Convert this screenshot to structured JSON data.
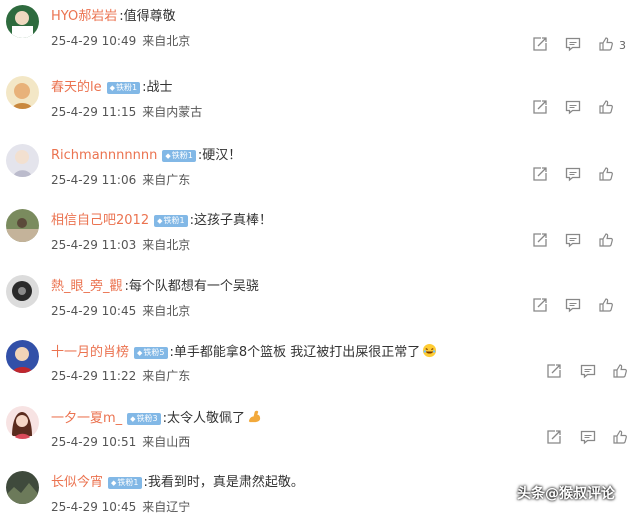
{
  "comments": [
    {
      "username": "HYO郝岩岩",
      "badge": "",
      "text": ":值得尊敬",
      "time": "25-4-29 10:49",
      "location": "来自北京",
      "likes": "3"
    },
    {
      "username": "春天的le",
      "badge": "铁粉1",
      "text": ":战士",
      "time": "25-4-29 11:15",
      "location": "来自内蒙古",
      "likes": ""
    },
    {
      "username": "Richmannnnnnn",
      "badge": "铁粉1",
      "text": ":硬汉！",
      "time": "25-4-29 11:06",
      "location": "来自广东",
      "likes": ""
    },
    {
      "username": "相信自己吧2012",
      "badge": "铁粉1",
      "text": ":这孩子真棒！",
      "time": "25-4-29 11:03",
      "location": "来自北京",
      "likes": ""
    },
    {
      "username": "熱_眼_旁_觀",
      "badge": "",
      "text": ":每个队都想有一个吴骁",
      "time": "25-4-29 10:45",
      "location": "来自北京",
      "likes": ""
    },
    {
      "username": "十一月的肖榜",
      "badge": "铁粉5",
      "text": ":单手都能拿8个篮板 我辽被打出屎很正常了",
      "time": "25-4-29 11:22",
      "location": "来自广东",
      "likes": ""
    },
    {
      "username": "一夕一夏m_",
      "badge": "铁粉3",
      "text": ":太令人敬佩了",
      "time": "25-4-29 10:51",
      "location": "来自山西",
      "likes": ""
    },
    {
      "username": "长似今宵",
      "badge": "铁粉1",
      "text": ":我看到时，真是肃然起敬。",
      "time": "25-4-29 10:45",
      "location": "来自辽宁",
      "likes": ""
    }
  ],
  "watermark": "头条@猴叔评论",
  "icons": {
    "repost": "repost-icon",
    "comment": "comment-icon",
    "like": "like-icon"
  },
  "colors": {
    "username": "#eb7350",
    "badge": "#82b8e6",
    "text": "#333333",
    "meta": "#555555",
    "icon": "#888888"
  }
}
